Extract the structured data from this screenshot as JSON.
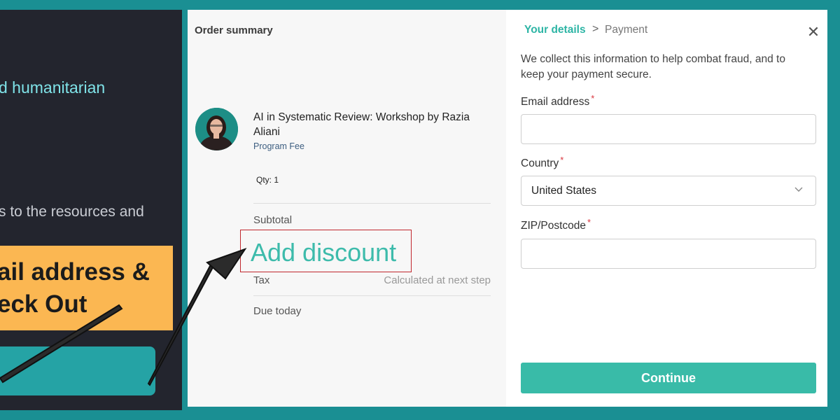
{
  "background": {
    "text_1": "d humanitarian",
    "text_2": "s to the resources and",
    "callout_line_1": "ail address &",
    "callout_line_2": "eck Out"
  },
  "summary": {
    "title": "Order summary",
    "product": {
      "name": "AI in Systematic Review: Workshop by Razia Aliani",
      "subtitle": "Program Fee",
      "qty": "Qty: 1"
    },
    "subtotal_label": "Subtotal",
    "discount_label": "Add discount",
    "tax_label": "Tax",
    "tax_value": "Calculated at next step",
    "due_label": "Due today"
  },
  "details": {
    "breadcrumb": {
      "active": "Your details",
      "separator": ">",
      "next": "Payment"
    },
    "close_glyph": "✕",
    "info": "We collect this information to help combat fraud, and to keep your payment secure.",
    "email": {
      "label": "Email address",
      "value": ""
    },
    "country": {
      "label": "Country",
      "selected": "United States"
    },
    "zip": {
      "label": "ZIP/Postcode",
      "value": ""
    },
    "required_mark": "*",
    "continue_label": "Continue"
  },
  "colors": {
    "frame": "#1a8f93",
    "accent": "#39bba8",
    "callout": "#fbb752",
    "highlight_border": "#c0272d"
  }
}
